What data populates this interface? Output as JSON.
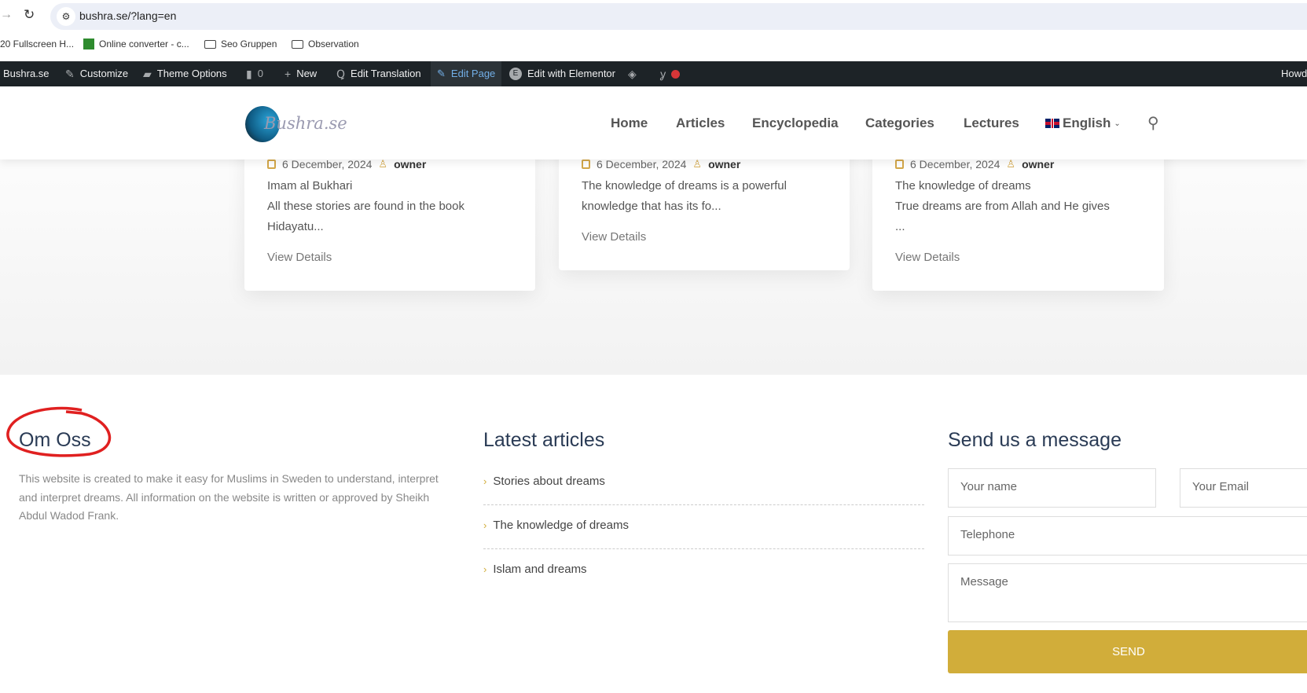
{
  "browser": {
    "url": "bushra.se/?lang=en",
    "bookmarks": [
      "20 Fullscreen H...",
      "Online converter - c...",
      "Seo Gruppen",
      "Observation"
    ]
  },
  "adminbar": {
    "site": "Bushra.se",
    "customize": "Customize",
    "theme_options": "Theme Options",
    "comments": "0",
    "new": "New",
    "edit_translation": "Edit Translation",
    "edit_page": "Edit Page",
    "elementor": "Edit with Elementor",
    "howdy": "Howd"
  },
  "header": {
    "logo": "Bushra.se",
    "nav": [
      "Home",
      "Articles",
      "Encyclopedia",
      "Categories",
      "Lectures"
    ],
    "language": "English"
  },
  "cards": [
    {
      "date": "6 December, 2024",
      "author": "owner",
      "lines": [
        "Imam al Bukhari",
        "All these stories are found in the book",
        "Hidayatu..."
      ],
      "link": "View Details"
    },
    {
      "date": "6 December, 2024",
      "author": "owner",
      "lines": [
        "The knowledge of dreams is a powerful",
        "knowledge that has its fo..."
      ],
      "link": "View Details"
    },
    {
      "date": "6 December, 2024",
      "author": "owner",
      "lines": [
        "The knowledge of dreams",
        "True dreams are from Allah and He gives",
        "..."
      ],
      "link": "View Details"
    }
  ],
  "footer": {
    "about": {
      "title": "Om Oss",
      "text": "This website is created to make it easy for Muslims in Sweden to understand, interpret and interpret dreams. All information on the website is written or approved by Sheikh Abdul Wadod Frank."
    },
    "latest": {
      "title": "Latest articles",
      "items": [
        "Stories about dreams",
        "The knowledge of dreams",
        "Islam and dreams"
      ]
    },
    "contact": {
      "title": "Send us a message",
      "name": "Your name",
      "email": "Your Email",
      "phone": "Telephone",
      "message": "Message",
      "send": "SEND"
    }
  },
  "colors": {
    "accent": "#d1ad3a",
    "adminbar": "#1d2327",
    "heading": "#2a3b55",
    "annotation": "#e02020"
  }
}
